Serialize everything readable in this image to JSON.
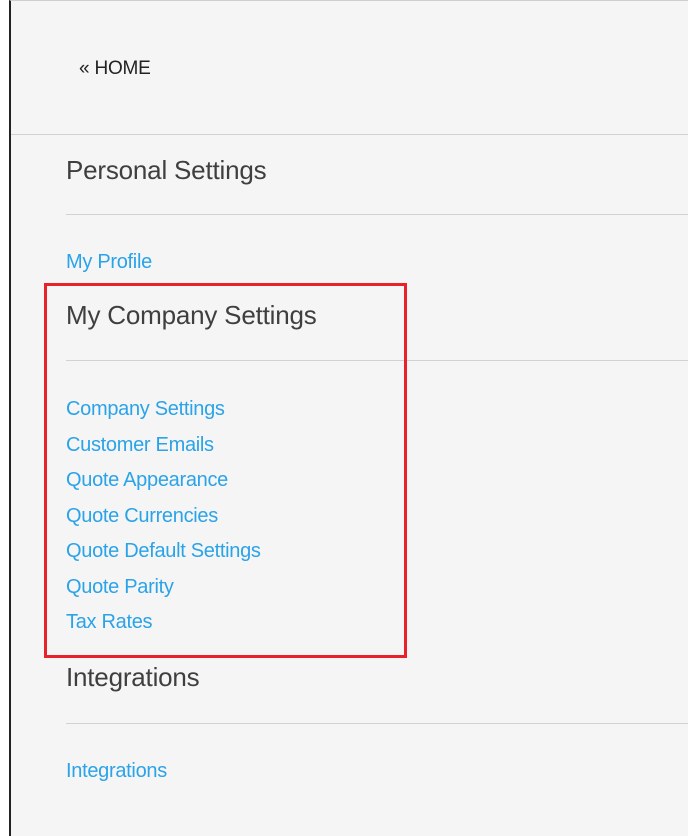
{
  "nav": {
    "home_label": "« HOME"
  },
  "sections": {
    "personal": {
      "title": "Personal Settings",
      "links": [
        "My Profile"
      ]
    },
    "company": {
      "title": "My Company Settings",
      "links": [
        "Company Settings",
        "Customer Emails",
        "Quote Appearance",
        "Quote Currencies",
        "Quote Default Settings",
        "Quote Parity",
        "Tax Rates"
      ]
    },
    "integrations": {
      "title": "Integrations",
      "links": [
        "Integrations"
      ]
    }
  },
  "colors": {
    "link": "#2aa3e8",
    "heading": "#3f3f3f",
    "highlight": "#e8212b",
    "background": "#f5f5f5"
  }
}
